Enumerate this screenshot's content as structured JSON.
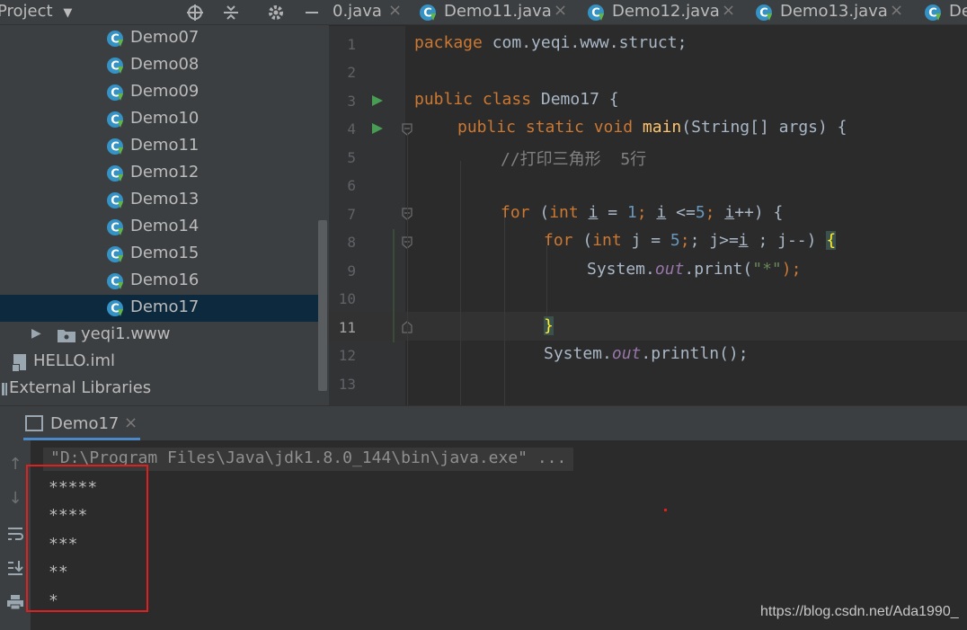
{
  "project_panel": {
    "title": "Project",
    "tree": [
      {
        "label": "Demo07",
        "kind": "class"
      },
      {
        "label": "Demo08",
        "kind": "class"
      },
      {
        "label": "Demo09",
        "kind": "class"
      },
      {
        "label": "Demo10",
        "kind": "class"
      },
      {
        "label": "Demo11",
        "kind": "class"
      },
      {
        "label": "Demo12",
        "kind": "class"
      },
      {
        "label": "Demo13",
        "kind": "class"
      },
      {
        "label": "Demo14",
        "kind": "class"
      },
      {
        "label": "Demo15",
        "kind": "class"
      },
      {
        "label": "Demo16",
        "kind": "class"
      },
      {
        "label": "Demo17",
        "kind": "class",
        "selected": true
      },
      {
        "label": "yeqi1.www",
        "kind": "package"
      },
      {
        "label": "HELLO.iml",
        "kind": "file"
      },
      {
        "label": "External Libraries",
        "kind": "libraries"
      }
    ]
  },
  "tabs": [
    {
      "label": "0.java"
    },
    {
      "label": "Demo11.java"
    },
    {
      "label": "Demo12.java"
    },
    {
      "label": "Demo13.java"
    },
    {
      "label": "De"
    }
  ],
  "tab_close_glyph": "×",
  "editor": {
    "line_numbers": [
      "1",
      "2",
      "3",
      "4",
      "5",
      "6",
      "7",
      "8",
      "9",
      "10",
      "11",
      "12",
      "13"
    ],
    "current_line": "11",
    "code": {
      "l1_kw": "package",
      "l1_rest": " com.yeqi.www.struct;",
      "l3_kw": "public class",
      "l3_rest": " Demo17 {",
      "l4_kw": "public static void",
      "l4_fn": "main",
      "l4_rest": "(String[] args) {",
      "l5_comment": "//打印三角形  5行",
      "l7_kw": "for",
      "l7_a": " (",
      "l7_int": "int",
      "l7_i1": "i",
      "l7_b": " = ",
      "l7_n1": "1",
      "l7_c": "; ",
      "l7_i2": "i",
      "l7_d": " <=",
      "l7_n2": "5",
      "l7_e": "; ",
      "l7_i3": "i",
      "l7_f": "++) {",
      "l8_kw": "for",
      "l8_a": " (",
      "l8_int": "int",
      "l8_b": " j = ",
      "l8_n": "5",
      "l8_c": "; j>=",
      "l8_i": "i",
      "l8_d": " ; j--) ",
      "l8_brace": "{",
      "l9_a": "System.",
      "l9_out": "out",
      "l9_b": ".print(",
      "l9_str": "\"*\"",
      "l9_c": ");",
      "l11_brace": "}",
      "l12_a": "System.",
      "l12_out": "out",
      "l12_b": ".println();"
    }
  },
  "run_panel": {
    "tab_label": "Demo17",
    "command": "\"D:\\Program Files\\Java\\jdk1.8.0_144\\bin\\java.exe\" ...",
    "output": [
      "*****",
      "****",
      "***",
      "**",
      "*"
    ]
  },
  "watermark": "https://blog.csdn.net/Ada1990_",
  "colors": {
    "background": "#2b2b2b",
    "panel": "#3c3f41",
    "selection": "#0d293e",
    "keyword": "#cc7832",
    "highlight_box": "#e02020"
  }
}
